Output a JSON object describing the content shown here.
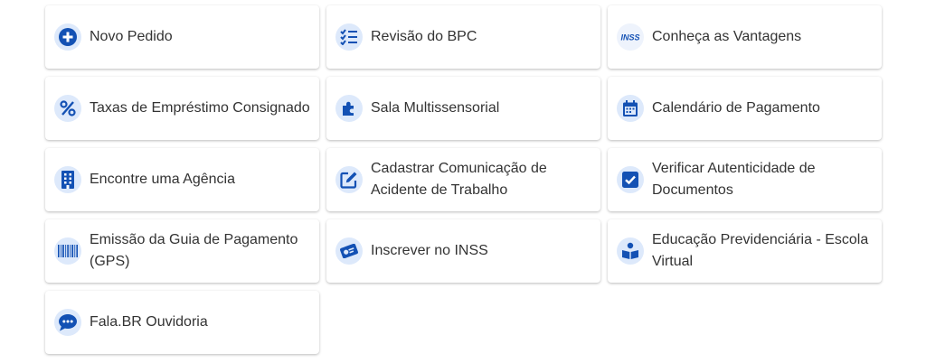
{
  "colors": {
    "accent": "#1351b4",
    "icon_bg": "#dde9fb",
    "text": "#333333"
  },
  "cards": [
    {
      "label": "Novo Pedido",
      "icon": "plus-circle-icon"
    },
    {
      "label": "Revisão do BPC",
      "icon": "checklist-icon"
    },
    {
      "label": "Conheça as Vantagens",
      "icon": "inss-logo-icon",
      "icon_text": "INSS"
    },
    {
      "label": "Taxas de Empréstimo Consignado",
      "icon": "percent-icon"
    },
    {
      "label": "Sala Multissensorial",
      "icon": "puzzle-icon"
    },
    {
      "label": "Calendário de Pagamento",
      "icon": "calendar-icon"
    },
    {
      "label": "Encontre uma Agência",
      "icon": "building-icon"
    },
    {
      "label": "Cadastrar Comunicação de Acidente de Trabalho",
      "icon": "edit-icon"
    },
    {
      "label": "Verificar Autenticidade de Documentos",
      "icon": "check-square-icon"
    },
    {
      "label": "Emissão da Guia de Pagamento (GPS)",
      "icon": "barcode-icon"
    },
    {
      "label": "Inscrever no INSS",
      "icon": "id-card-icon"
    },
    {
      "label": "Educação Previdenciária - Escola Virtual",
      "icon": "reading-person-icon"
    },
    {
      "label": "Fala.BR Ouvidoria",
      "icon": "chat-bubble-icon"
    }
  ]
}
